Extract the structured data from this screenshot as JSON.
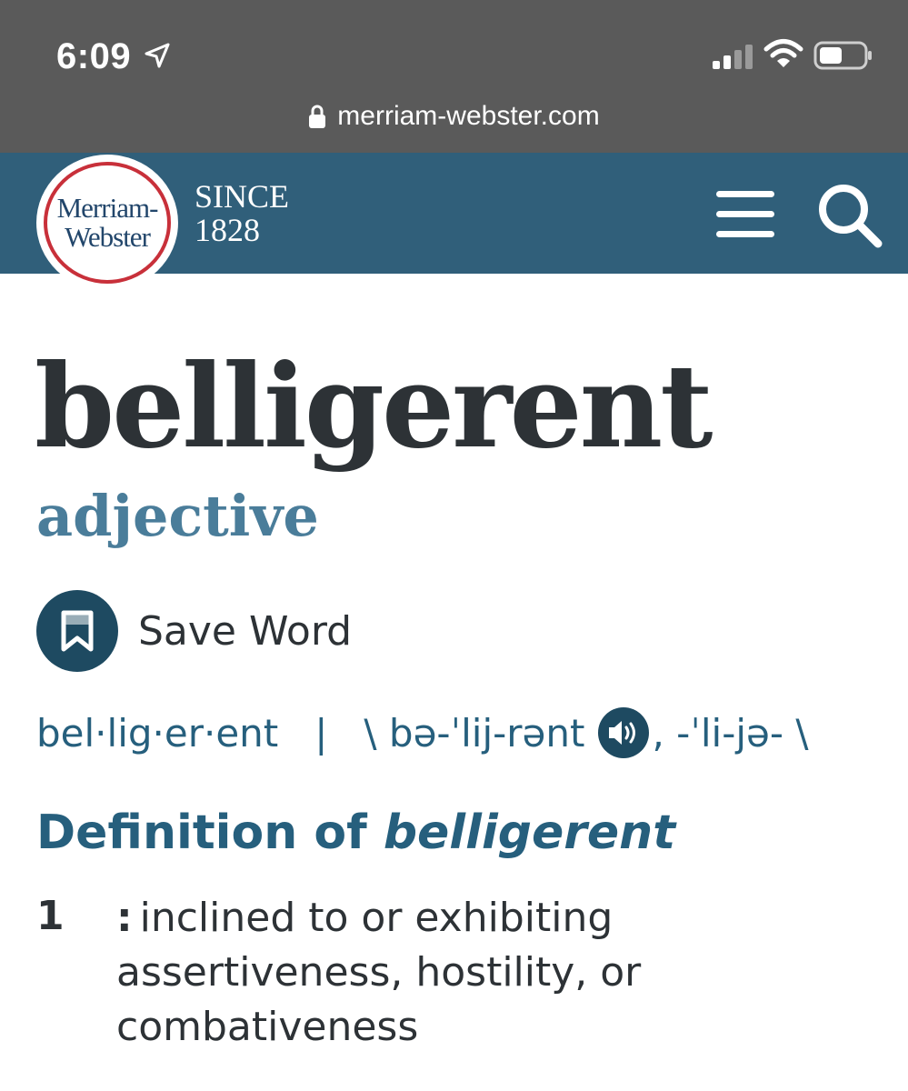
{
  "status_bar": {
    "time": "6:09",
    "url": "merriam-webster.com"
  },
  "header": {
    "logo_line1": "Merriam-",
    "logo_line2": "Webster",
    "since_line1": "SINCE",
    "since_line2": "1828"
  },
  "entry": {
    "headword": "belligerent",
    "part_of_speech": "adjective",
    "save_label": "Save Word",
    "syllabification": "bel·lig·er·ent",
    "separator": "|",
    "pronunciation_main": "\\ bə-ˈlij-rənt",
    "pronunciation_variant": ", -ˈli-jə- \\",
    "definition_heading_prefix": "Definition of ",
    "definition_heading_word": "belligerent",
    "senses": [
      {
        "number": "1",
        "colon": ":",
        "text": "inclined to or exhibiting assertiveness, hostility, or combativeness"
      }
    ]
  },
  "colors": {
    "status_bar_bg": "#5a5a5a",
    "header_bg": "#305f7a",
    "logo_ring": "#c8303a",
    "headword": "#2d3236",
    "part_of_speech": "#4a7d9a",
    "link_blue": "#265f7d"
  },
  "icons": {
    "location": "location-arrow-icon",
    "signal": "cellular-signal-icon",
    "wifi": "wifi-icon",
    "battery": "battery-icon",
    "lock": "lock-icon",
    "menu": "hamburger-menu-icon",
    "search": "search-icon",
    "save": "bookmark-icon",
    "audio": "speaker-icon"
  }
}
